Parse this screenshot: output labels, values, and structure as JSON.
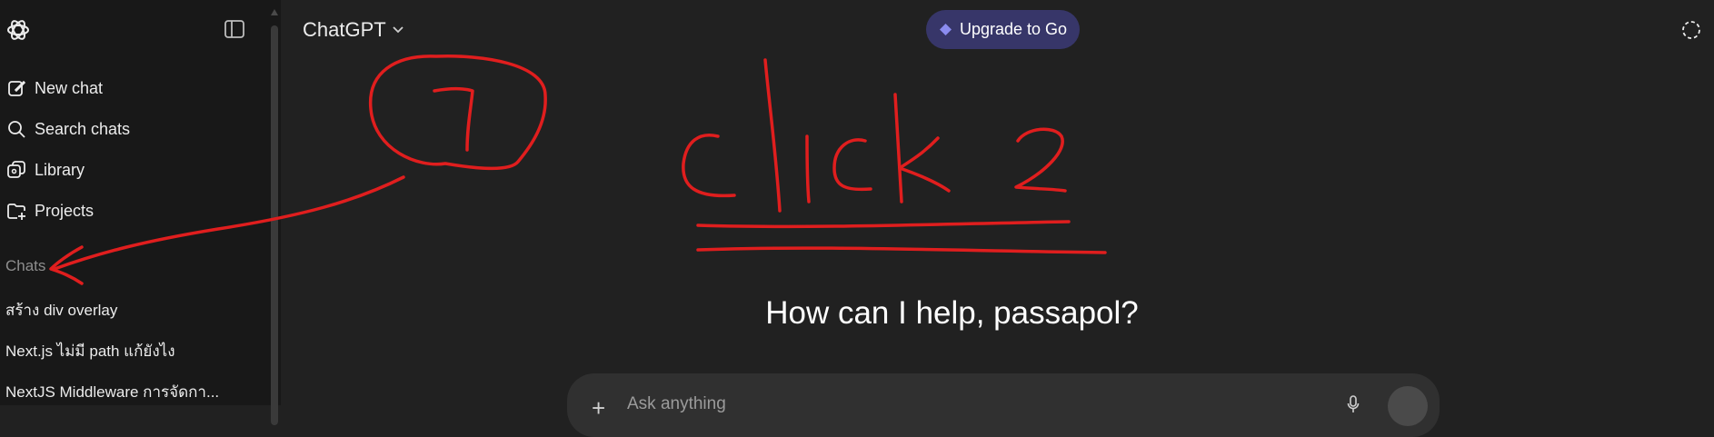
{
  "sidebar": {
    "nav": [
      {
        "label": "New chat",
        "icon": "edit-icon"
      },
      {
        "label": "Search chats",
        "icon": "search-icon"
      },
      {
        "label": "Library",
        "icon": "library-icon"
      },
      {
        "label": "Projects",
        "icon": "folder-plus-icon"
      }
    ],
    "section_label": "Chats",
    "chats": [
      "สร้าง div overlay",
      "Next.js ไม่มี path แก้ยังไง",
      "NextJS Middleware การจัดกา..."
    ]
  },
  "topbar": {
    "model_label": "ChatGPT",
    "upgrade_label": "Upgrade to Go"
  },
  "main": {
    "greeting": "How can I help, passapol?",
    "composer_placeholder": "Ask anything"
  },
  "annotation": {
    "number_label": "1",
    "instruction": "click 2",
    "color": "#e01e1e"
  },
  "colors": {
    "background": "#212121",
    "sidebar": "#181818",
    "upgrade_bg": "#373669",
    "upgrade_diamond": "#8b8cf0"
  }
}
